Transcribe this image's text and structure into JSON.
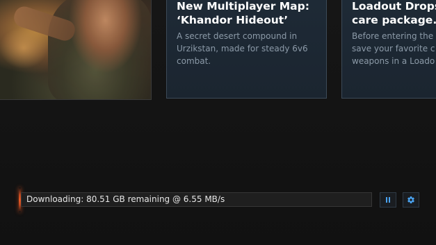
{
  "news": {
    "cards": [
      {
        "title": "New Multiplayer Map:\n‘Khandor Hideout’",
        "description": "A secret desert compound in\nUrzikstan, made for steady 6v6\ncombat."
      },
      {
        "title": "Loadout Drops.\ncare package.",
        "description": "Before entering the\nsave your favorite c\nweapons in a Loado"
      }
    ]
  },
  "download": {
    "status_text": "Downloading: 80.51 GB remaining @ 6.55 MB/s",
    "pause_icon": "pause-icon",
    "settings_icon": "gear-icon",
    "accent_color": "#e55a25",
    "icon_color": "#4aa3f0"
  }
}
